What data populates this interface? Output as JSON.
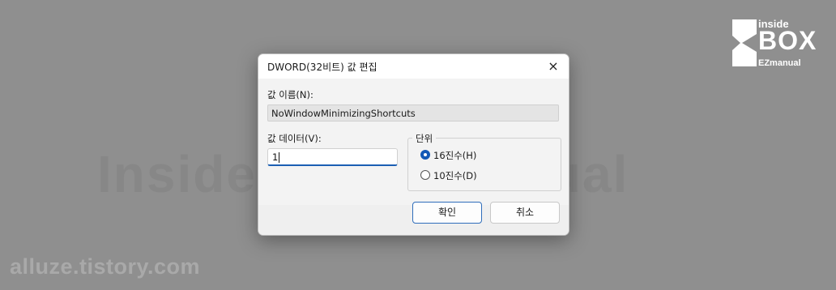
{
  "background": {
    "watermark_text": "InsideBOXEzmanual",
    "site_text": "alluze.tistory.com",
    "logo": {
      "line1": "inside",
      "line2": "BOX",
      "line3": "EZmanual"
    }
  },
  "dialog": {
    "title": "DWORD(32비트) 값 편집",
    "close_icon": "×",
    "value_name_label": "값 이름(N):",
    "value_name": "NoWindowMinimizingShortcuts",
    "value_data_label": "값 데이터(V):",
    "value_data": "1",
    "base": {
      "label": "단위",
      "options": [
        {
          "label": "16진수(H)",
          "selected": true
        },
        {
          "label": "10진수(D)",
          "selected": false
        }
      ]
    },
    "ok_label": "확인",
    "cancel_label": "취소"
  },
  "colors": {
    "accent": "#1259b6",
    "background": "#8f8f8f"
  }
}
